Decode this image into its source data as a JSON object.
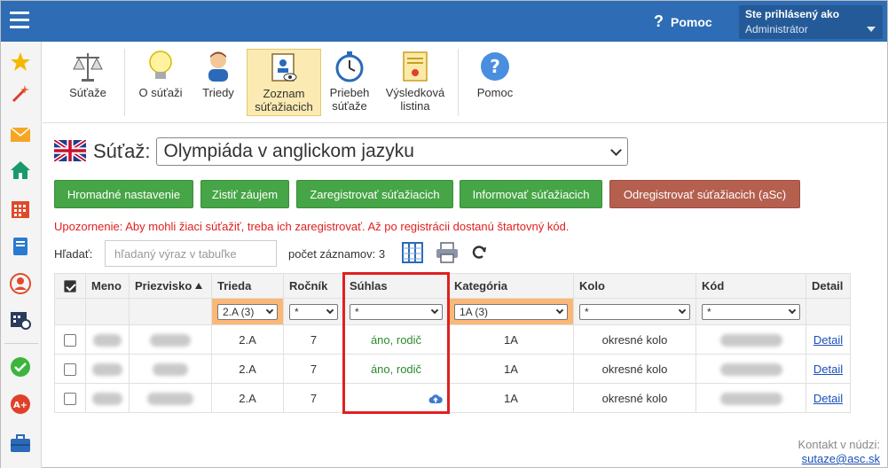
{
  "topbar": {
    "help_label": "Pomoc",
    "help_glyph": "?",
    "user_label": "Ste prihlásený ako",
    "user_role": "Administrátor"
  },
  "rail": {
    "icons": [
      "star-icon",
      "magic-wand-icon",
      "envelope-icon",
      "home-icon",
      "calendar-grid-icon",
      "notebook-icon",
      "person-icon",
      "calendar-clock-icon",
      "check-circle-icon",
      "grade-badge-icon",
      "briefcase-icon"
    ]
  },
  "toolbar": {
    "items": [
      {
        "label": "Súťaže",
        "icon": "scales-icon"
      },
      {
        "label": "O súťaži",
        "icon": "lightbulb-icon"
      },
      {
        "label": "Triedy",
        "icon": "student-icon"
      },
      {
        "label": "Zoznam súťažiacich",
        "icon": "contestant-list-icon",
        "active": true
      },
      {
        "label": "Priebeh súťaže",
        "icon": "stopwatch-icon"
      },
      {
        "label": "Výsledková listina",
        "icon": "certificate-icon"
      },
      {
        "label": "Pomoc",
        "icon": "help-icon"
      }
    ]
  },
  "competition": {
    "label": "Súťaž:",
    "selected": "Olympiáda v anglickom jazyku",
    "flag": "uk-flag-icon"
  },
  "actions": {
    "bulk": "Hromadné nastavenie",
    "interest": "Zistiť záujem",
    "register": "Zaregistrovať súťažiacich",
    "inform": "Informovať súťažiacich",
    "unregister": "Odregistrovať súťažiacich (aSc)"
  },
  "warning": "Upozornenie: Aby mohli žiaci súťažiť, treba ich zaregistrovať. Až po registrácii dostanú štartovný kód.",
  "search": {
    "label": "Hľadať:",
    "placeholder": "hľadaný výraz v tabuľke",
    "count_label": "počet záznamov: 3"
  },
  "table": {
    "headers": {
      "meno": "Meno",
      "priezvisko": "Priezvisko",
      "trieda": "Trieda",
      "rocnik": "Ročník",
      "suhlas": "Súhlas",
      "kategoria": "Kategória",
      "kolo": "Kolo",
      "kod": "Kód",
      "detail": "Detail"
    },
    "filters": {
      "trieda": "2.A (3)",
      "rocnik": "*",
      "suhlas": "*",
      "kategoria": "1A (3)",
      "kolo": "*",
      "kod": "*"
    },
    "rows": [
      {
        "trieda": "2.A",
        "rocnik": "7",
        "suhlas": "áno, rodič",
        "kategoria": "1A",
        "kolo": "okresné kolo",
        "detail": "Detail"
      },
      {
        "trieda": "2.A",
        "rocnik": "7",
        "suhlas": "áno, rodič",
        "kategoria": "1A",
        "kolo": "okresné kolo",
        "detail": "Detail"
      },
      {
        "trieda": "2.A",
        "rocnik": "7",
        "suhlas": "",
        "kategoria": "1A",
        "kolo": "okresné kolo",
        "detail": "Detail"
      }
    ]
  },
  "contact": {
    "label": "Kontakt v núdzi:",
    "email": "sutaze@asc.sk"
  },
  "colors": {
    "topbar": "#2e6db5",
    "primary_button": "#46a546",
    "danger_button": "#b55f4f",
    "filter_highlight": "#f9b878",
    "annotation": "#e02020"
  }
}
